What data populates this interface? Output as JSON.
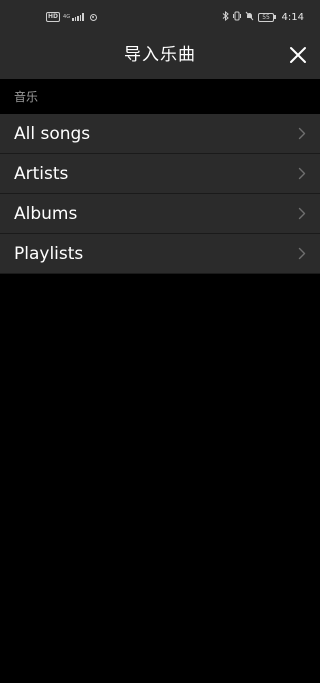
{
  "status_bar": {
    "hd_label": "HD",
    "network_type": "4G",
    "battery_level": "55",
    "time": "4:14"
  },
  "header": {
    "title": "导入乐曲",
    "close_icon": "close-icon"
  },
  "section": {
    "label": "音乐"
  },
  "list": {
    "items": [
      {
        "label": "All songs",
        "icon": "chevron-right-icon"
      },
      {
        "label": "Artists",
        "icon": "chevron-right-icon"
      },
      {
        "label": "Albums",
        "icon": "chevron-right-icon"
      },
      {
        "label": "Playlists",
        "icon": "chevron-right-icon"
      }
    ]
  },
  "colors": {
    "bar_background": "#2b2b2b",
    "page_background": "#000000",
    "section_text": "#9a9a9a",
    "chevron": "#6e6e6e"
  }
}
